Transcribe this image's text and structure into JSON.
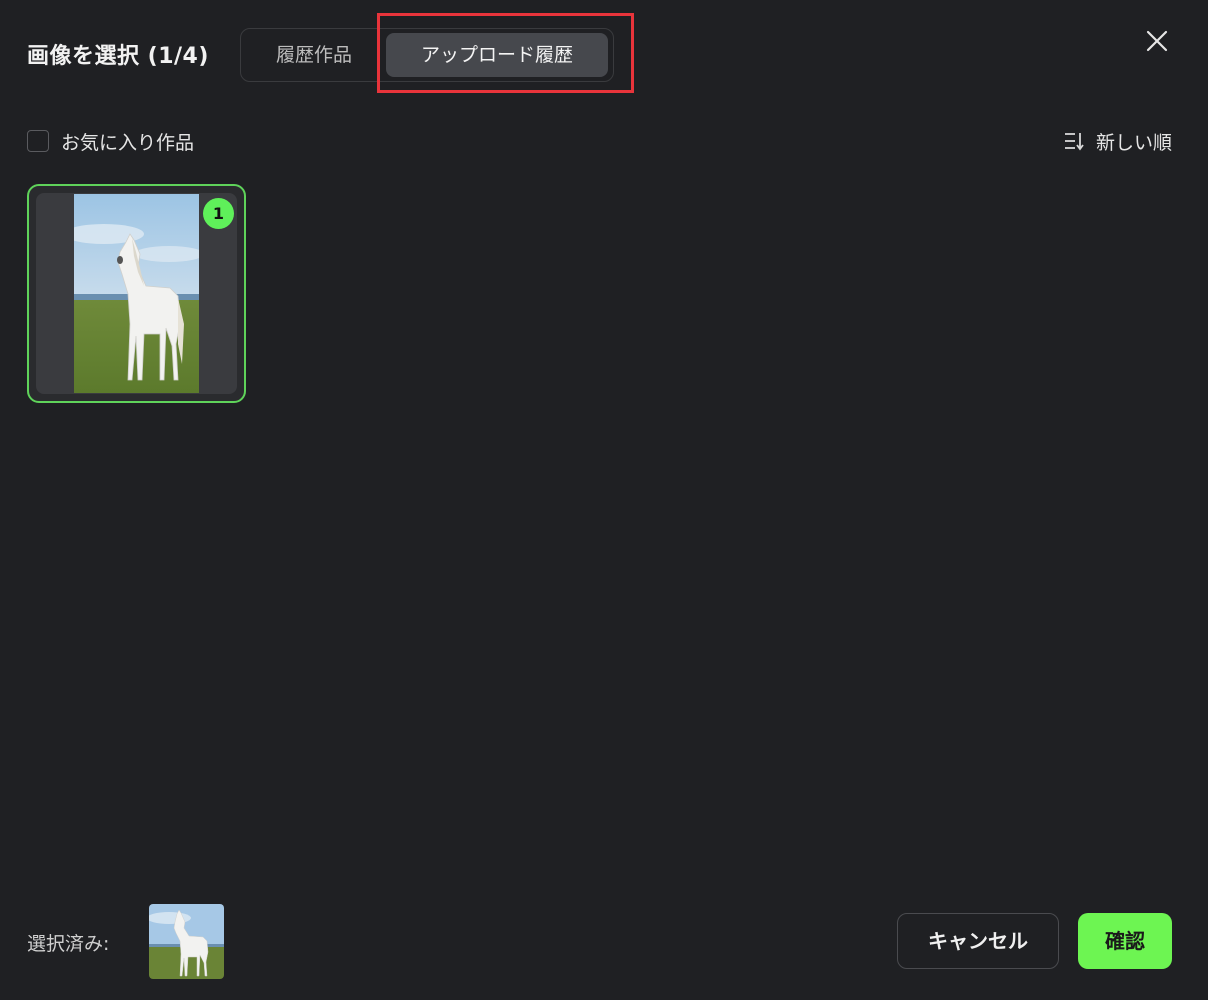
{
  "dialog": {
    "title": "画像を選択 (1/4)",
    "close_icon": "close-icon"
  },
  "tabs": [
    {
      "label": "履歴作品",
      "active": false
    },
    {
      "label": "アップロード履歴",
      "active": true
    }
  ],
  "filters": {
    "favorites_label": "お気に入り作品",
    "favorites_checked": false,
    "sort_icon": "sort-icon",
    "sort_label": "新しい順"
  },
  "gallery": {
    "items": [
      {
        "badge": "1",
        "image": "white-horse-on-grass-photo",
        "selected": true
      }
    ]
  },
  "footer": {
    "selected_label": "選択済み:",
    "cancel_label": "キャンセル",
    "confirm_label": "確認"
  },
  "colors": {
    "background": "#1f2023",
    "accent_green": "#6df552",
    "highlight_red": "#e8343b",
    "active_tab_bg": "#46484d"
  }
}
